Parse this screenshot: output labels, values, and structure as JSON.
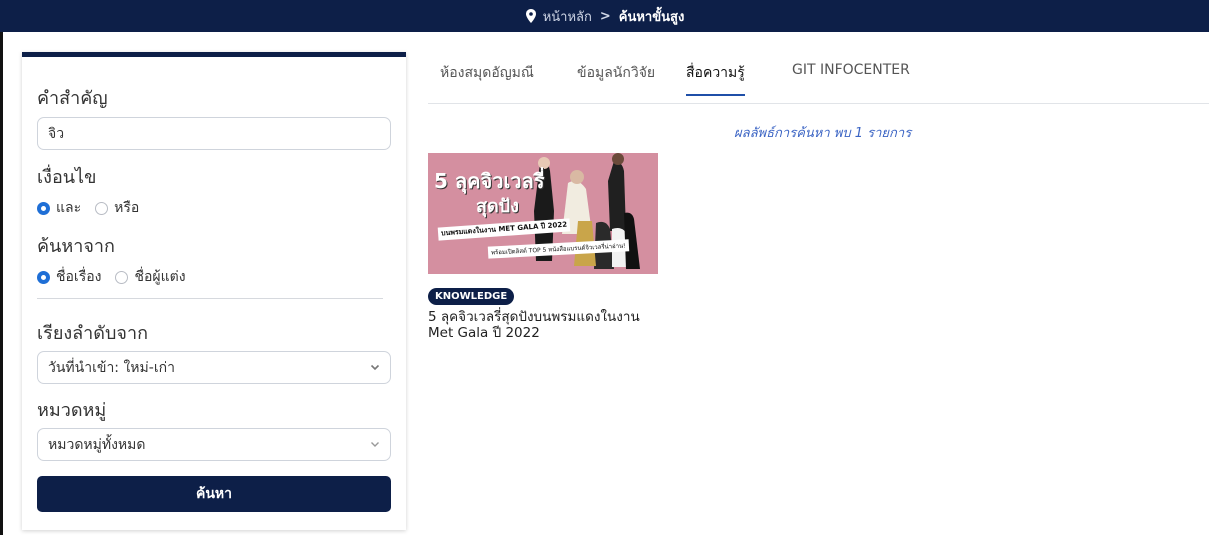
{
  "breadcrumb": {
    "home": "หน้าหลัก",
    "separator": ">",
    "current": "ค้นหาขั้นสูง",
    "icon": "map-pin-icon"
  },
  "search": {
    "keyword_label": "คำสำคัญ",
    "keyword_value": "จิว",
    "condition_label": "เงื่อนไข",
    "condition_options": [
      "และ",
      "หรือ"
    ],
    "condition_selected": "และ",
    "searchfrom_label": "ค้นหาจาก",
    "searchfrom_options": [
      "ชื่อเรื่อง",
      "ชื่อผู้แต่ง"
    ],
    "searchfrom_selected": "ชื่อเรื่อง",
    "sort_label": "เรียงลำดับจาก",
    "sort_value": "วันที่นำเข้า: ใหม่-เก่า",
    "category_label": "หมวดหมู่",
    "category_value": "หมวดหมู่ทั้งหมด",
    "button": "ค้นหา"
  },
  "tabs": [
    {
      "label": "ห้องสมุดอัญมณี",
      "active": false
    },
    {
      "label": "ข้อมูลนักวิจัย",
      "active": false
    },
    {
      "label": "สื่อความรู้",
      "active": true
    },
    {
      "label": "GIT INFOCENTER",
      "active": false
    }
  ],
  "result_info": "ผลลัพธ์การค้นหา พบ 1 รายการ",
  "results": [
    {
      "badge": "KNOWLEDGE",
      "title_line1": "5 ลุคจิวเวลรี่สุดปังบนพรมแดงในงาน",
      "title_line2": "Met Gala ปี 2022",
      "thumb_text1": "5 ลุคจิวเวลรี่",
      "thumb_text2": "สุดปัง",
      "thumb_text3": "บนพรมแดงในงาน MET GALA ปี 2022",
      "thumb_text4": "พร้อมเปิดลิสต์ TOP 5 หนังสือแบรนด์จิวเวลรี่น่าอ่าน!",
      "thumb_bg": "#d48fa0"
    }
  ],
  "colors": {
    "navy": "#0d1f48",
    "accent_blue": "#1f6fd6",
    "result_text": "#3b64c4"
  }
}
